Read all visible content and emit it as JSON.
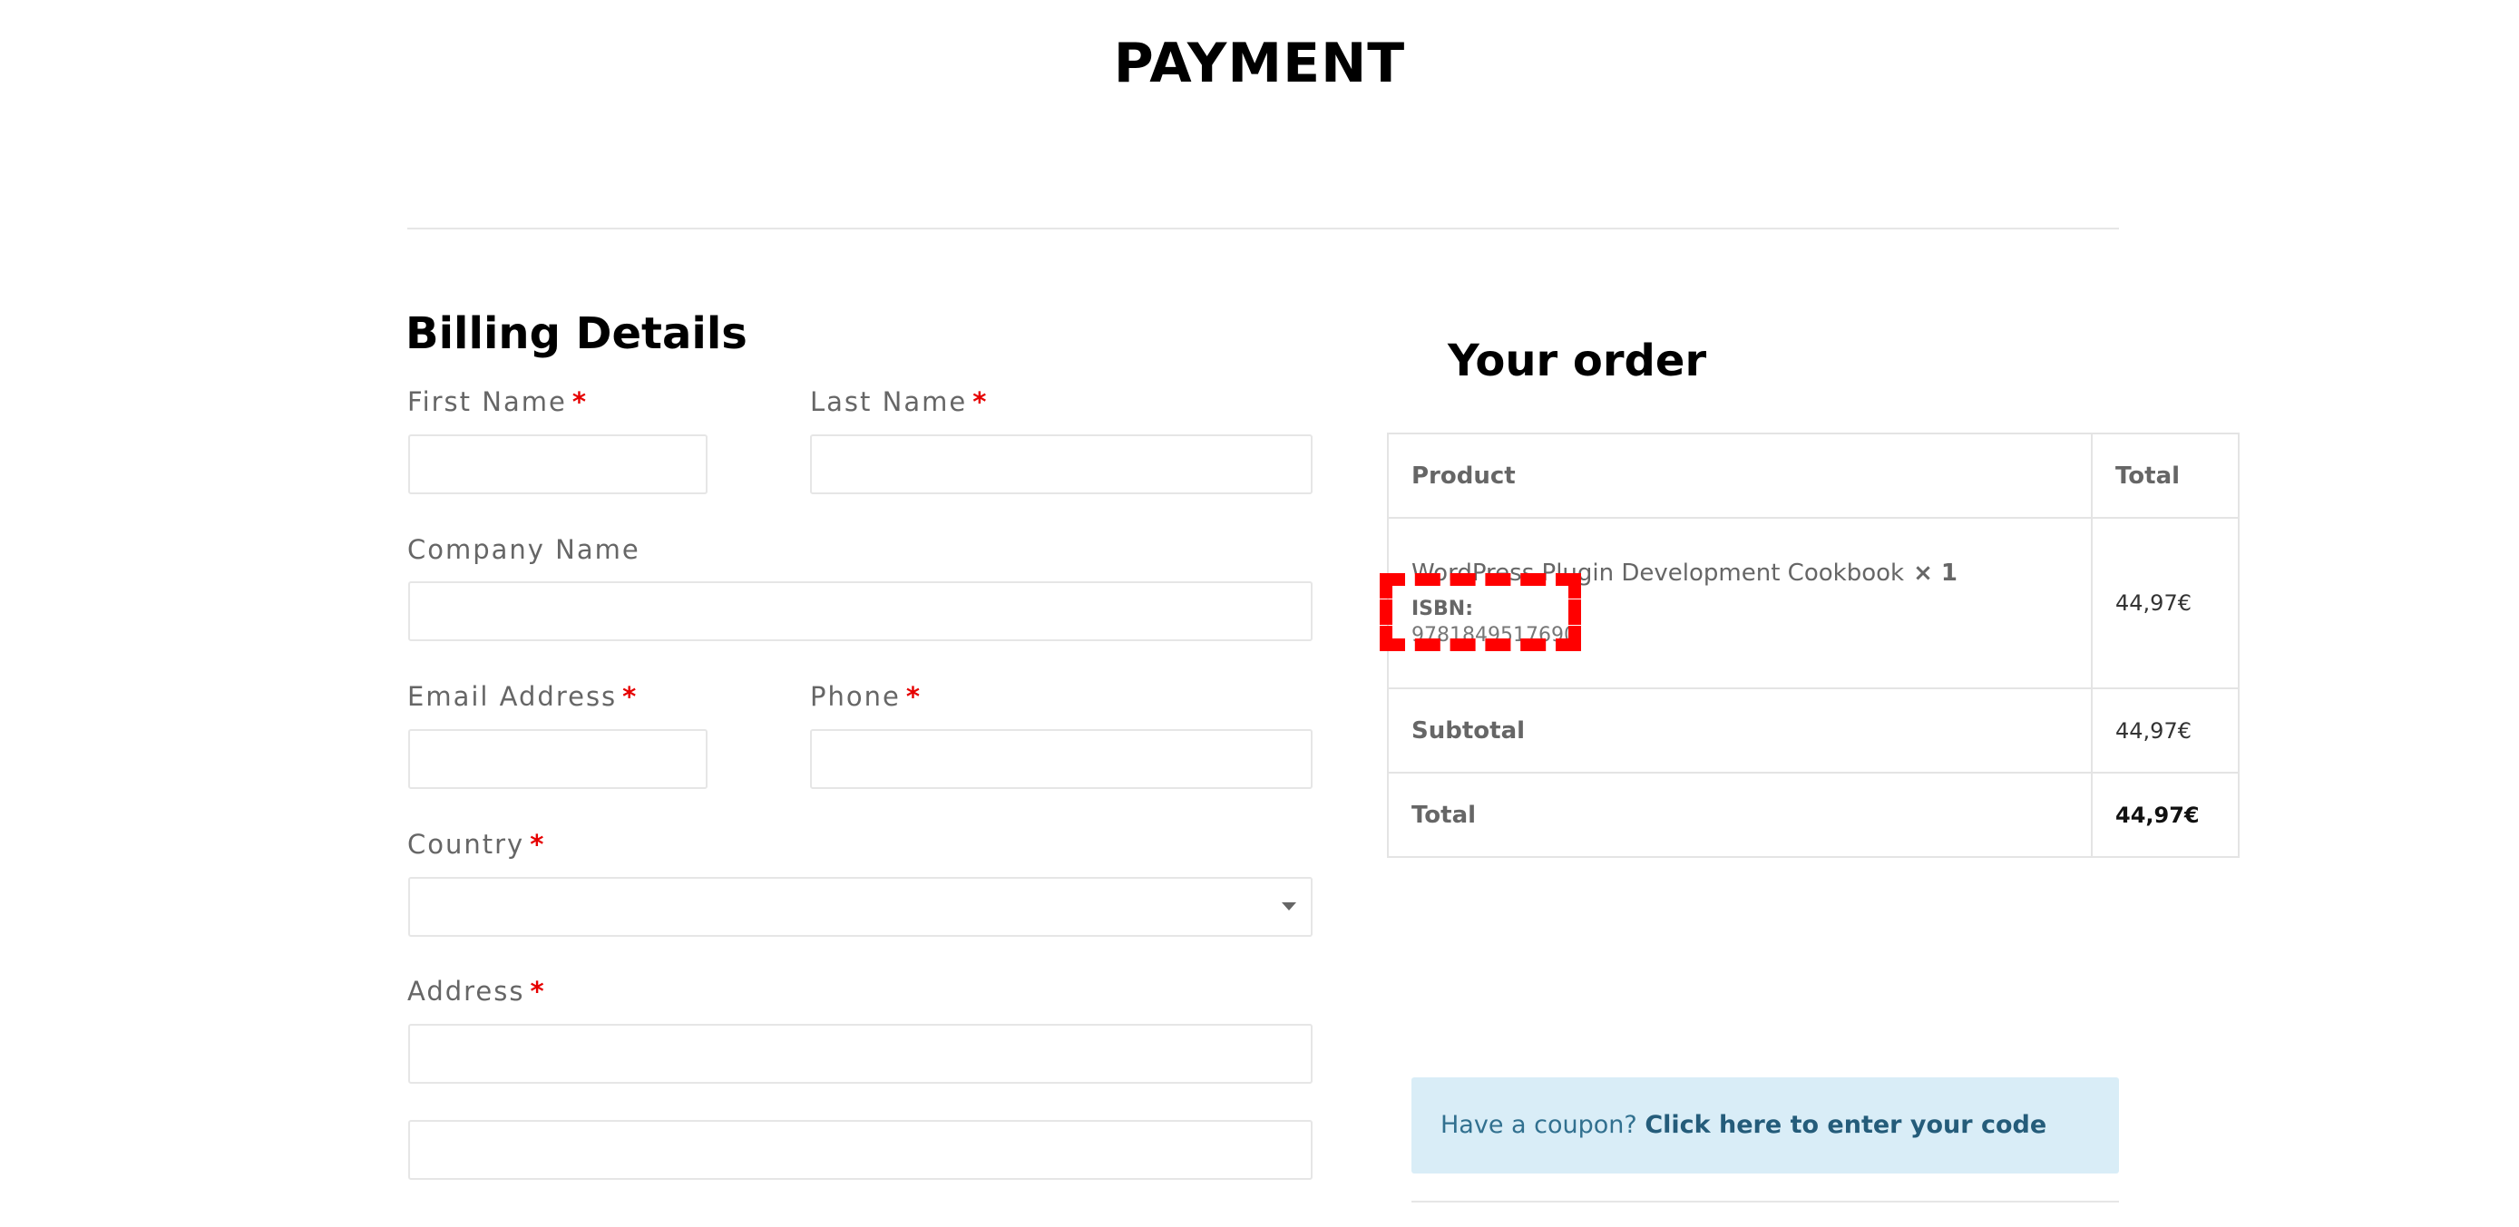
{
  "page": {
    "title": "PAYMENT"
  },
  "billing": {
    "title": "Billing Details",
    "required_marker": "*",
    "fields": {
      "first_name": {
        "label": "First Name",
        "value": "",
        "required": true
      },
      "last_name": {
        "label": "Last Name",
        "value": "",
        "required": true
      },
      "company": {
        "label": "Company Name",
        "value": "",
        "required": false
      },
      "email": {
        "label": "Email Address",
        "value": "",
        "required": true
      },
      "phone": {
        "label": "Phone",
        "value": "",
        "required": true
      },
      "country": {
        "label": "Country",
        "value": "",
        "required": true
      },
      "address_1": {
        "label": "Address",
        "value": "",
        "required": true
      },
      "address_2": {
        "value": ""
      }
    }
  },
  "order": {
    "title": "Your order",
    "columns": {
      "product": "Product",
      "total": "Total"
    },
    "items": [
      {
        "name": "WordPress Plugin Development Cookbook",
        "qty": "× 1",
        "meta_label": "ISBN:",
        "meta_value": "9781849517690",
        "total": "44,97€"
      }
    ],
    "subtotal_label": "Subtotal",
    "subtotal": "44,97€",
    "total_label": "Total",
    "total": "44,97€"
  },
  "coupon": {
    "prompt": "Have a coupon?",
    "link": "Click here to enter your code"
  },
  "colors": {
    "required": "#e60000",
    "coupon_bg": "#d9edf7",
    "coupon_text": "#31708f",
    "highlight": "#ff0000"
  }
}
